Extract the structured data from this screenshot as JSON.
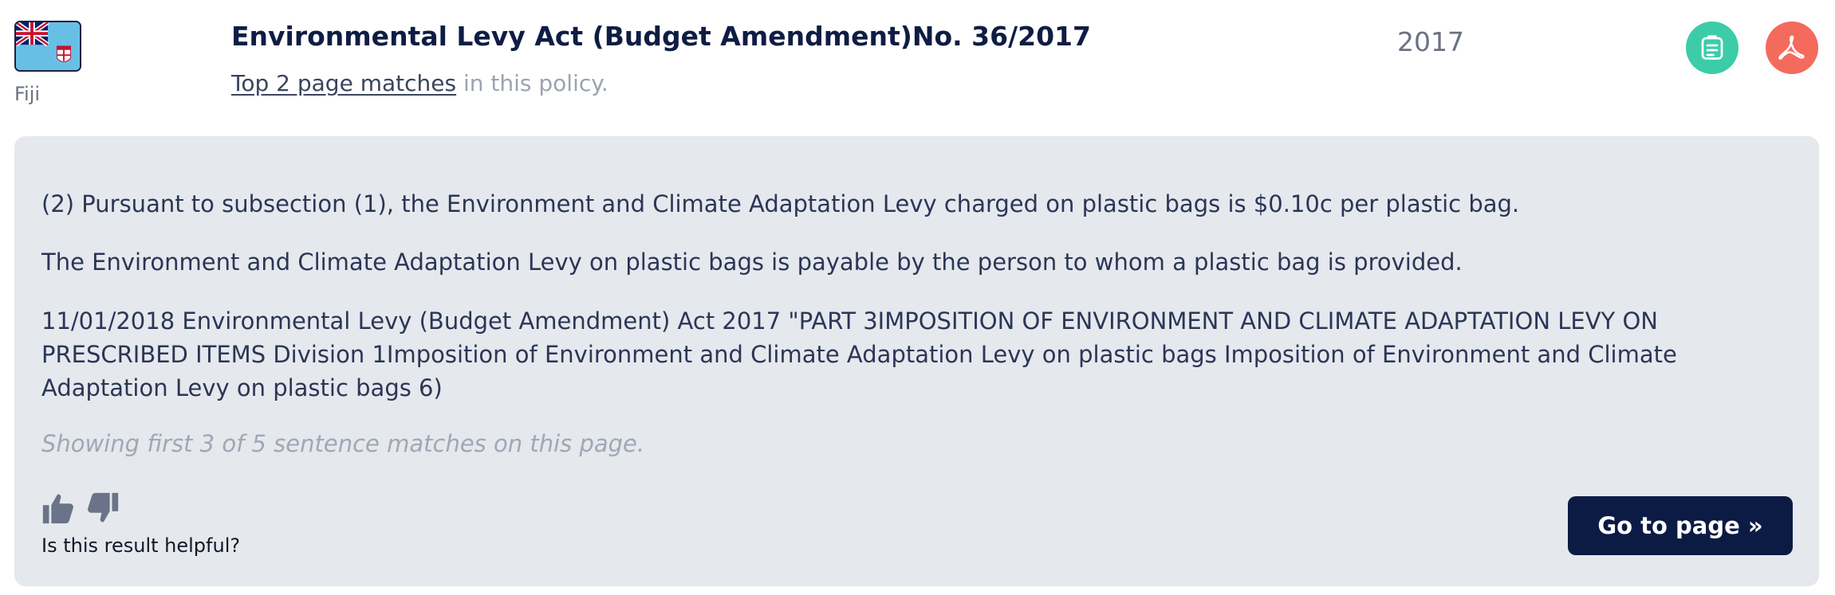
{
  "header": {
    "country": "Fiji",
    "title": "Environmental Levy Act (Budget Amendment)No. 36/2017",
    "matches_link": "Top 2 page matches",
    "matches_suffix": " in this policy.",
    "year": "2017",
    "icons": {
      "summary": "document-list-icon",
      "pdf": "pdf-icon",
      "flag": "fiji-flag-icon"
    }
  },
  "result": {
    "sentences": [
      "(2) Pursuant to subsection (1), the Environment and Climate Adaptation Levy charged on plastic bags is $0.10c per plastic bag.",
      "The Environment and Climate Adaptation Levy on plastic bags is payable by the person to whom a plastic bag is provided.",
      "11/01/2018 Environmental Levy (Budget Amendment) Act 2017 \"PART 3IMPOSITION OF ENVIRONMENT AND CLIMATE ADAPTATION LEVY ON PRESCRIBED ITEMS Division 1Imposition of Environment and Climate Adaptation Levy on plastic bags Imposition of Environment and Climate Adaptation Levy on plastic bags 6)"
    ],
    "note": "Showing first 3 of 5 sentence matches on this page.",
    "feedback_label": "Is this result helpful?",
    "goto_label": "Go to page »"
  },
  "colors": {
    "summary_button": "#3dcca8",
    "pdf_button": "#f46b5d",
    "card_background": "#e5e8ed",
    "primary_button": "#0b1b44",
    "title": "#0f1d44"
  }
}
